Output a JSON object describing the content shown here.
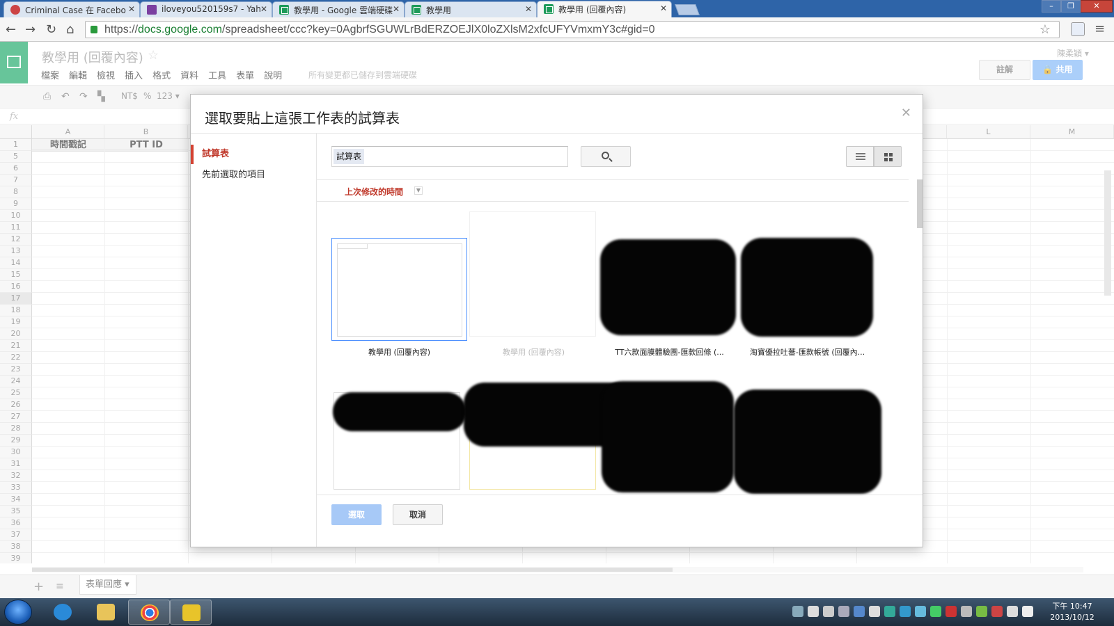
{
  "browser": {
    "tabs": [
      {
        "title": "Criminal Case 在 Facebo",
        "icon": "facebook-game-icon"
      },
      {
        "title": "iloveyou520159s7 - Yah",
        "icon": "mail-icon"
      },
      {
        "title": "教學用 - Google 雲端硬碟",
        "icon": "sheets-icon"
      },
      {
        "title": "教學用",
        "icon": "sheets-icon"
      },
      {
        "title": "教學用 (回覆內容)",
        "icon": "sheets-icon",
        "active": true
      }
    ],
    "url_scheme": "https://",
    "url_host": "docs.google.com",
    "url_path": "/spreadsheet/ccc?key=0AgbrfSGUWLrBdERZOEJlX0loZXlsM2xfcUFYVmxmY3c#gid=0"
  },
  "app": {
    "doc_title": "教學用 (回覆內容)",
    "menu": [
      "檔案",
      "編輯",
      "檢視",
      "插入",
      "格式",
      "資料",
      "工具",
      "表單",
      "說明"
    ],
    "saved_msg": "所有變更都已儲存到雲端硬碟",
    "user": "陳柔穎 ▾",
    "comments_label": "註解",
    "share_label": "共用",
    "toolbar": {
      "currency": "NT$",
      "percent": "%",
      "number_format": "123 ▾"
    },
    "fx_label": "fx"
  },
  "grid": {
    "columns": [
      "A",
      "B",
      "L",
      "M"
    ],
    "header_cells": [
      "時間戳記",
      "PTT ID"
    ],
    "rows": [
      "1",
      "5",
      "6",
      "7",
      "8",
      "9",
      "10",
      "11",
      "12",
      "13",
      "14",
      "15",
      "16",
      "17",
      "18",
      "19",
      "20",
      "21",
      "22",
      "23",
      "24",
      "25",
      "26",
      "27",
      "28",
      "29",
      "30",
      "31",
      "32",
      "33",
      "34",
      "35",
      "36",
      "37",
      "38",
      "39"
    ],
    "selected_row": "17"
  },
  "sheet_tabs": [
    "表單回應 ▾"
  ],
  "dialog": {
    "title": "選取要貼上這張工作表的試算表",
    "nav": [
      {
        "label": "試算表",
        "active": true
      },
      {
        "label": "先前選取的項目",
        "active": false
      }
    ],
    "search_chip": "試算表",
    "sort_label": "上次修改的時間",
    "files": [
      {
        "label": "教學用 (回覆內容)",
        "state": "selected"
      },
      {
        "label": "教學用 (回覆內容)",
        "state": "faded"
      },
      {
        "label": "TT六款面膜體驗團-匯款回條 (...",
        "state": "redacted"
      },
      {
        "label": "淘寶優拉吐蕃-匯款帳號 (回覆內...",
        "state": "redacted"
      }
    ],
    "select_label": "選取",
    "cancel_label": "取消"
  },
  "taskbar": {
    "time": "下午 10:47",
    "date": "2013/10/12",
    "apps": [
      "internet-explorer-icon",
      "file-explorer-icon",
      "chrome-icon",
      "game-app-icon"
    ]
  }
}
